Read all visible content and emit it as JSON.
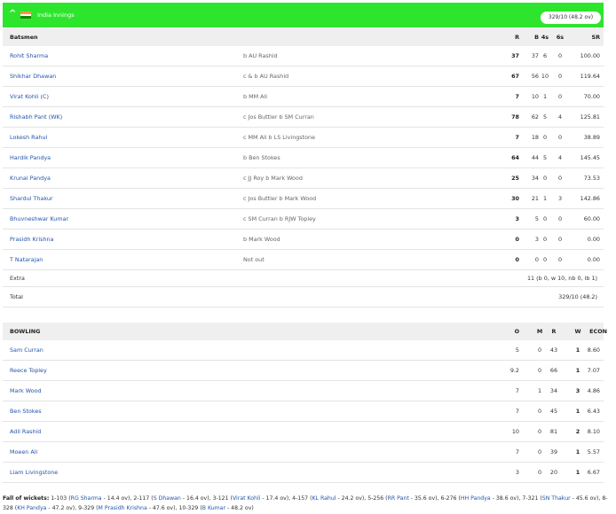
{
  "innings": {
    "team": "India Innings",
    "score": "329/10 (48.2 ov)"
  },
  "batting": {
    "headers": {
      "name": "Batsmen",
      "r": "R",
      "b": "B",
      "fours": "4s",
      "sixes": "6s",
      "sr": "SR"
    },
    "rows": [
      {
        "name": "Rohit Sharma",
        "dismissal": "b AU Rashid",
        "r": "37",
        "b": "37",
        "fours": "6",
        "sixes": "0",
        "sr": "100.00"
      },
      {
        "name": "Shikhar Dhawan",
        "dismissal": "c & b AU Rashid",
        "r": "67",
        "b": "56",
        "fours": "10",
        "sixes": "0",
        "sr": "119.64"
      },
      {
        "name": "Virat Kohli (C)",
        "dismissal": "b MM Ali",
        "r": "7",
        "b": "10",
        "fours": "1",
        "sixes": "0",
        "sr": "70.00"
      },
      {
        "name": "Rishabh Pant (WK)",
        "dismissal": "c Jos Buttler b SM Curran",
        "r": "78",
        "b": "62",
        "fours": "5",
        "sixes": "4",
        "sr": "125.81"
      },
      {
        "name": "Lokesh Rahul",
        "dismissal": "c MM Ali b LS Livingstone",
        "r": "7",
        "b": "18",
        "fours": "0",
        "sixes": "0",
        "sr": "38.89"
      },
      {
        "name": "Hardik Pandya",
        "dismissal": "b Ben Stokes",
        "r": "64",
        "b": "44",
        "fours": "5",
        "sixes": "4",
        "sr": "145.45"
      },
      {
        "name": "Krunal Pandya",
        "dismissal": "c JJ Roy b Mark Wood",
        "r": "25",
        "b": "34",
        "fours": "0",
        "sixes": "0",
        "sr": "73.53"
      },
      {
        "name": "Shardul Thakur",
        "dismissal": "c Jos Buttler b Mark Wood",
        "r": "30",
        "b": "21",
        "fours": "1",
        "sixes": "3",
        "sr": "142.86"
      },
      {
        "name": "Bhuvneshwar Kumar",
        "dismissal": "c SM Curran b RJW Topley",
        "r": "3",
        "b": "5",
        "fours": "0",
        "sixes": "0",
        "sr": "60.00"
      },
      {
        "name": "Prasidh Krishna",
        "dismissal": "b Mark Wood",
        "r": "0",
        "b": "3",
        "fours": "0",
        "sixes": "0",
        "sr": "0.00"
      },
      {
        "name": "T Natarajan",
        "dismissal": "Not out",
        "r": "0",
        "b": "0",
        "fours": "0",
        "sixes": "0",
        "sr": "0.00"
      }
    ],
    "extra": {
      "label": "Extra",
      "value": "11 (b 0, w 10, nb 0, lb 1)"
    },
    "total": {
      "label": "Total",
      "value": "329/10 (48.2)"
    }
  },
  "bowling": {
    "headers": {
      "name": "BOWLING",
      "o": "O",
      "m": "M",
      "r": "R",
      "w": "W",
      "econ": "ECON"
    },
    "rows": [
      {
        "name": "Sam Curran",
        "o": "5",
        "m": "0",
        "r": "43",
        "w": "1",
        "econ": "8.60"
      },
      {
        "name": "Reece Topley",
        "o": "9.2",
        "m": "0",
        "r": "66",
        "w": "1",
        "econ": "7.07"
      },
      {
        "name": "Mark Wood",
        "o": "7",
        "m": "1",
        "r": "34",
        "w": "3",
        "econ": "4.86"
      },
      {
        "name": "Ben Stokes",
        "o": "7",
        "m": "0",
        "r": "45",
        "w": "1",
        "econ": "6.43"
      },
      {
        "name": "Adil Rashid",
        "o": "10",
        "m": "0",
        "r": "81",
        "w": "2",
        "econ": "8.10"
      },
      {
        "name": "Moeen Ali",
        "o": "7",
        "m": "0",
        "r": "39",
        "w": "1",
        "econ": "5.57"
      },
      {
        "name": "Liam Livingstone",
        "o": "3",
        "m": "0",
        "r": "20",
        "w": "1",
        "econ": "6.67"
      }
    ]
  },
  "fall_of_wickets": {
    "label": "Fall of wickets:",
    "items": [
      {
        "pre": "1-103 (",
        "player": "RG Sharma",
        "post": " - 14.4 ov), "
      },
      {
        "pre": "2-117 (",
        "player": "S Dhawan",
        "post": " - 16.4 ov), "
      },
      {
        "pre": "3-121 (",
        "player": "Virat Kohli",
        "post": " - 17.4 ov), "
      },
      {
        "pre": "4-157 (",
        "player": "KL Rahul",
        "post": " - 24.2 ov), "
      },
      {
        "pre": "5-256 (",
        "player": "RR Pant",
        "post": " - 35.6 ov), "
      },
      {
        "pre": "6-276 (",
        "player": "HH Pandya",
        "post": " - 38.6 ov), "
      },
      {
        "pre": "7-321 (",
        "player": "SN Thakur",
        "post": " - 45.6 ov), "
      },
      {
        "pre": "8-328 (",
        "player": "KH Pandya",
        "post": " - 47.2 ov), "
      },
      {
        "pre": "9-329 (",
        "player": "M Prasidh Krishna",
        "post": " - 47.6 ov), "
      },
      {
        "pre": "10-329 (",
        "player": "B Kumar",
        "post": " - 48.2 ov)"
      }
    ]
  },
  "colors": {
    "header_green": "#2ee52e",
    "player_link": "#2255aa",
    "row_header_bg": "#efefef"
  }
}
